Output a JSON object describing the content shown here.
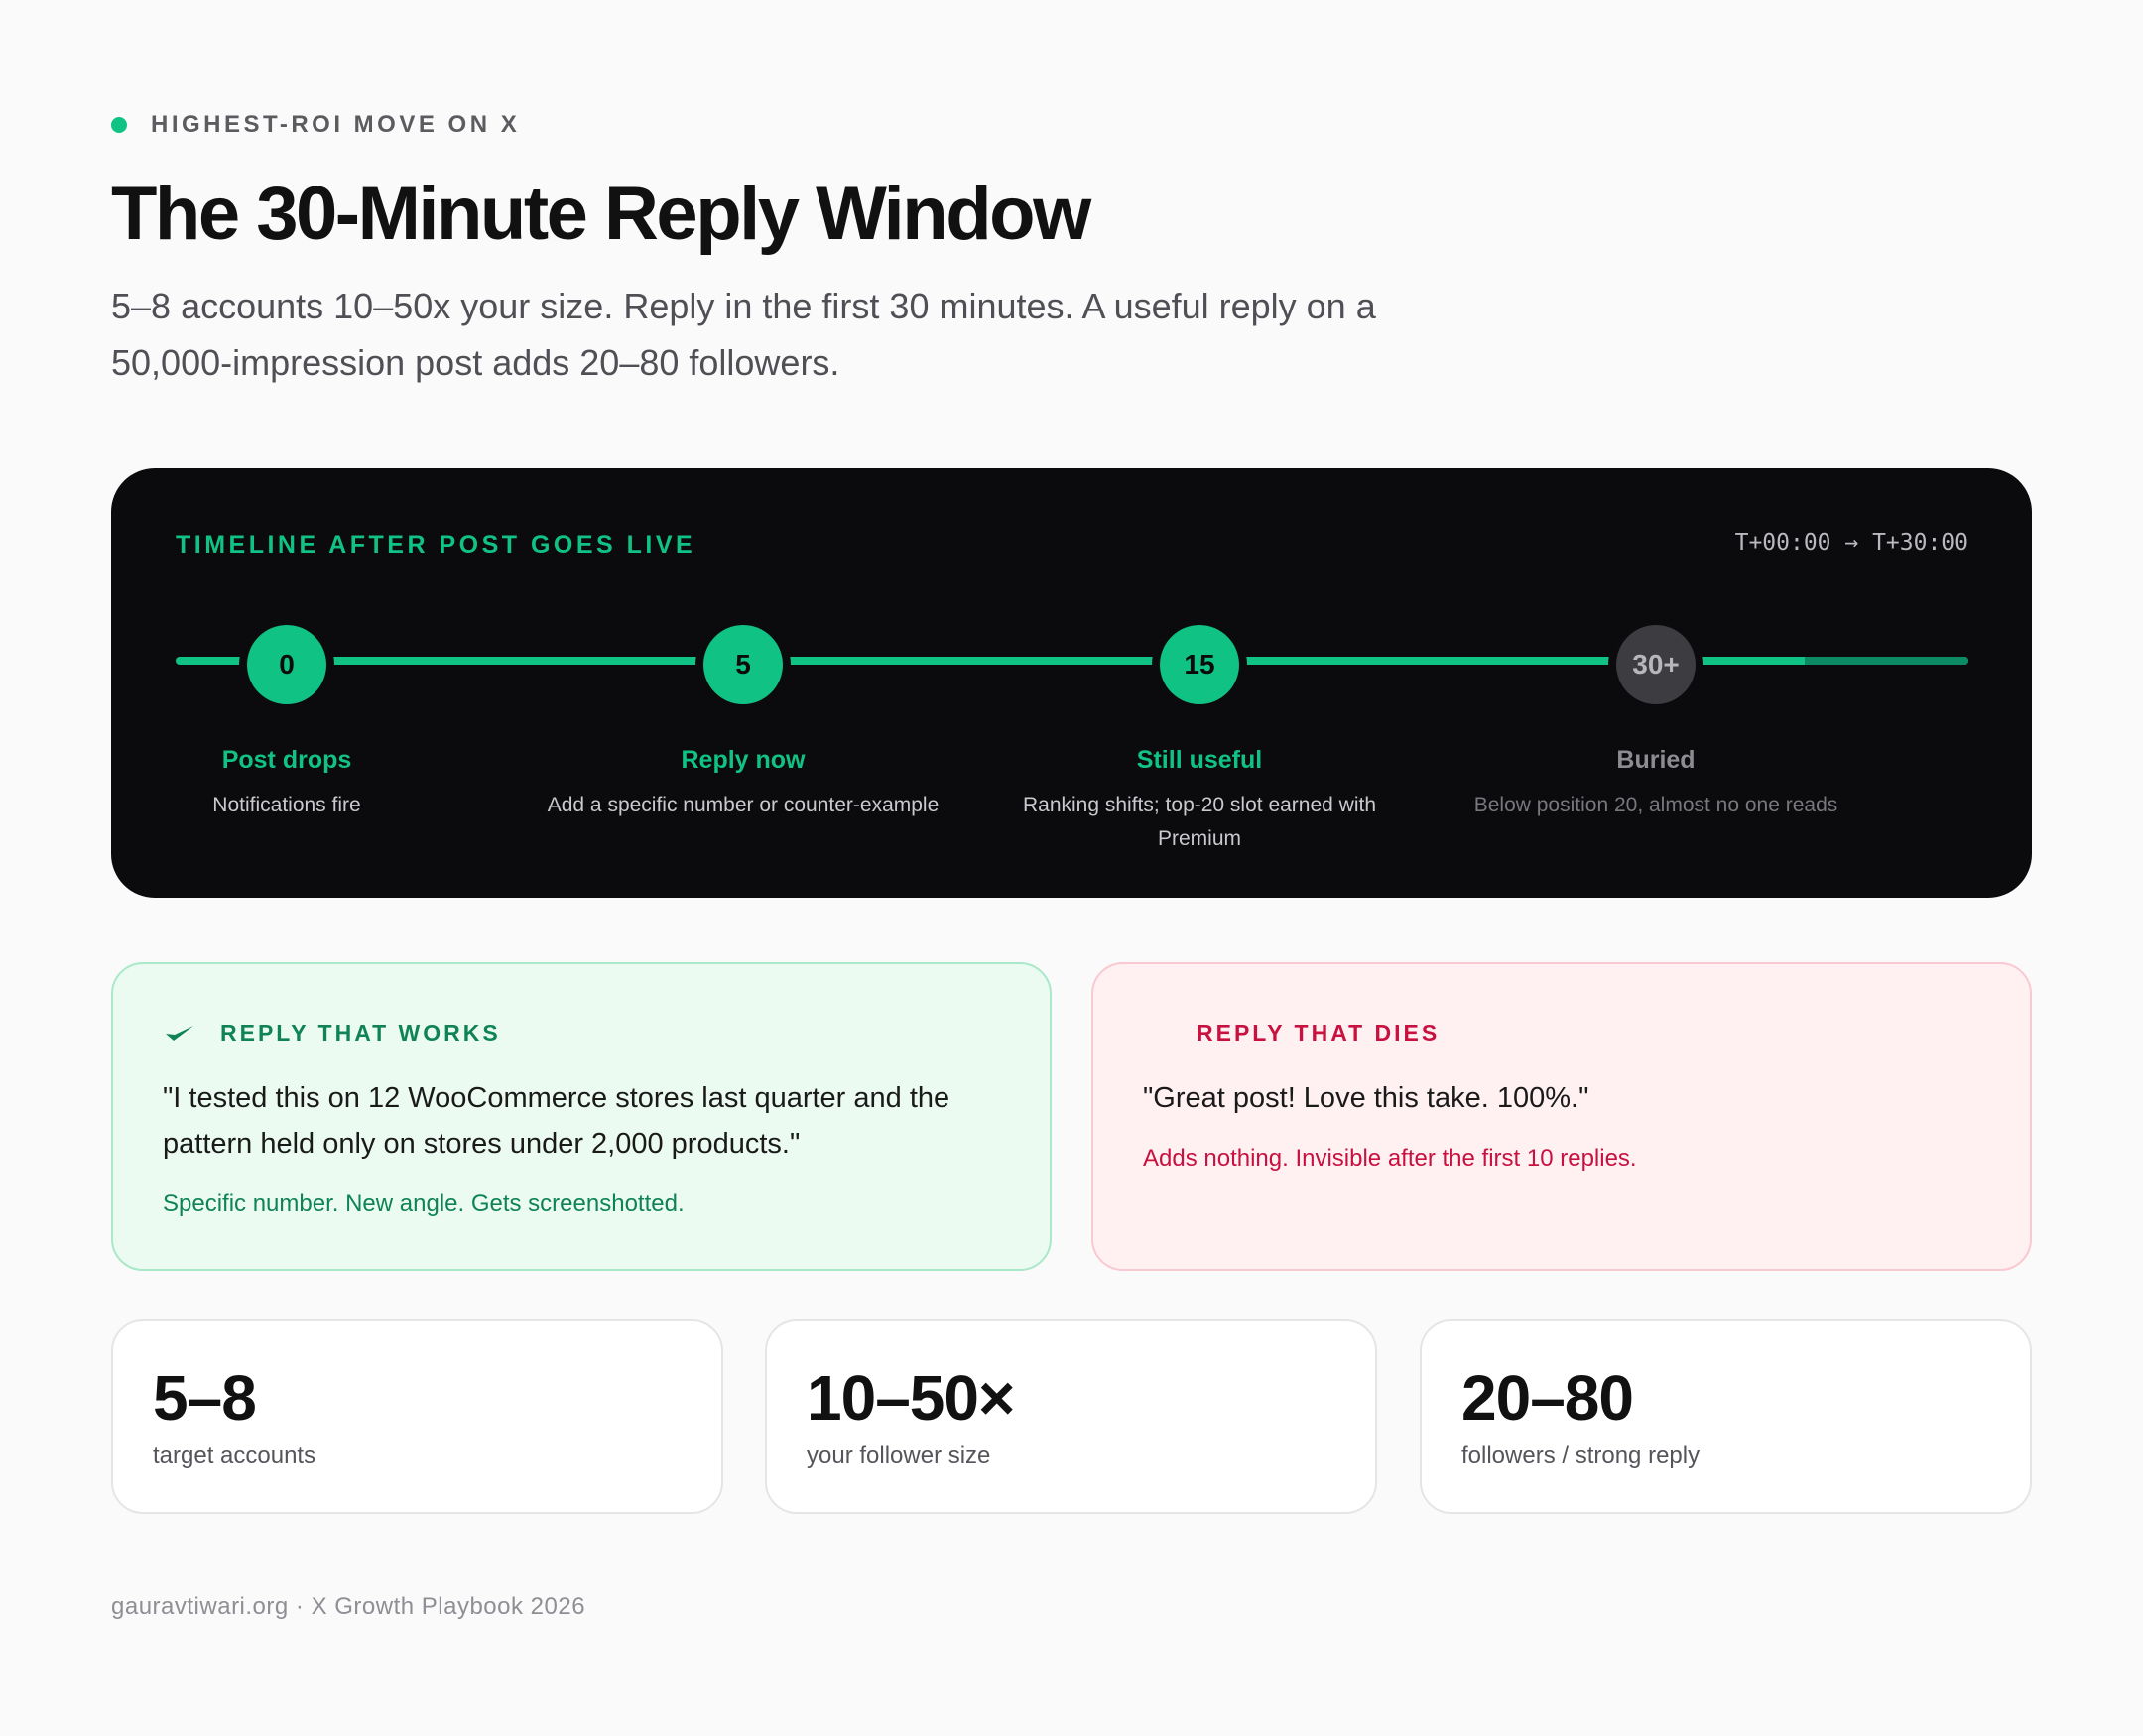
{
  "header": {
    "eyebrow": "HIGHEST-ROI MOVE ON X",
    "title": "The 30-Minute Reply Window",
    "subtitle": "5–8 accounts 10–50x your size. Reply in the first 30 minutes. A useful reply on a 50,000-impression post adds 20–80 followers."
  },
  "timeline": {
    "label": "TIMELINE AFTER POST GOES LIVE",
    "range": "T+00:00 → T+30:00",
    "stops": [
      {
        "marker": "0",
        "name": "Post drops",
        "desc": "Notifications fire"
      },
      {
        "marker": "5",
        "name": "Reply now",
        "desc": "Add a specific number or counter-example"
      },
      {
        "marker": "15",
        "name": "Still useful",
        "desc": "Ranking shifts; top-20 slot earned with Premium"
      },
      {
        "marker": "30+",
        "name": "Buried",
        "desc": "Below position 20, almost no one reads"
      }
    ]
  },
  "good_reply": {
    "heading": "REPLY THAT WORKS",
    "quote": "\"I tested this on 12 WooCommerce stores last quarter and the pattern held only on stores under 2,000 products.\"",
    "note": "Specific number. New angle. Gets screenshotted."
  },
  "bad_reply": {
    "heading": "REPLY THAT DIES",
    "quote": "\"Great post! Love this take. 100%.\"",
    "note": "Adds nothing. Invisible after the first 10 replies."
  },
  "stats": [
    {
      "value": "5–8",
      "caption": "target accounts"
    },
    {
      "value": "10–50×",
      "caption": "your follower size"
    },
    {
      "value": "20–80",
      "caption": "followers / strong reply"
    }
  ],
  "footer": "gauravtiwari.org · X Growth Playbook 2026",
  "colors": {
    "accent": "#10c283",
    "good": "#0f8356",
    "bad": "#c8113f",
    "card_dark": "#0b0b0d"
  }
}
